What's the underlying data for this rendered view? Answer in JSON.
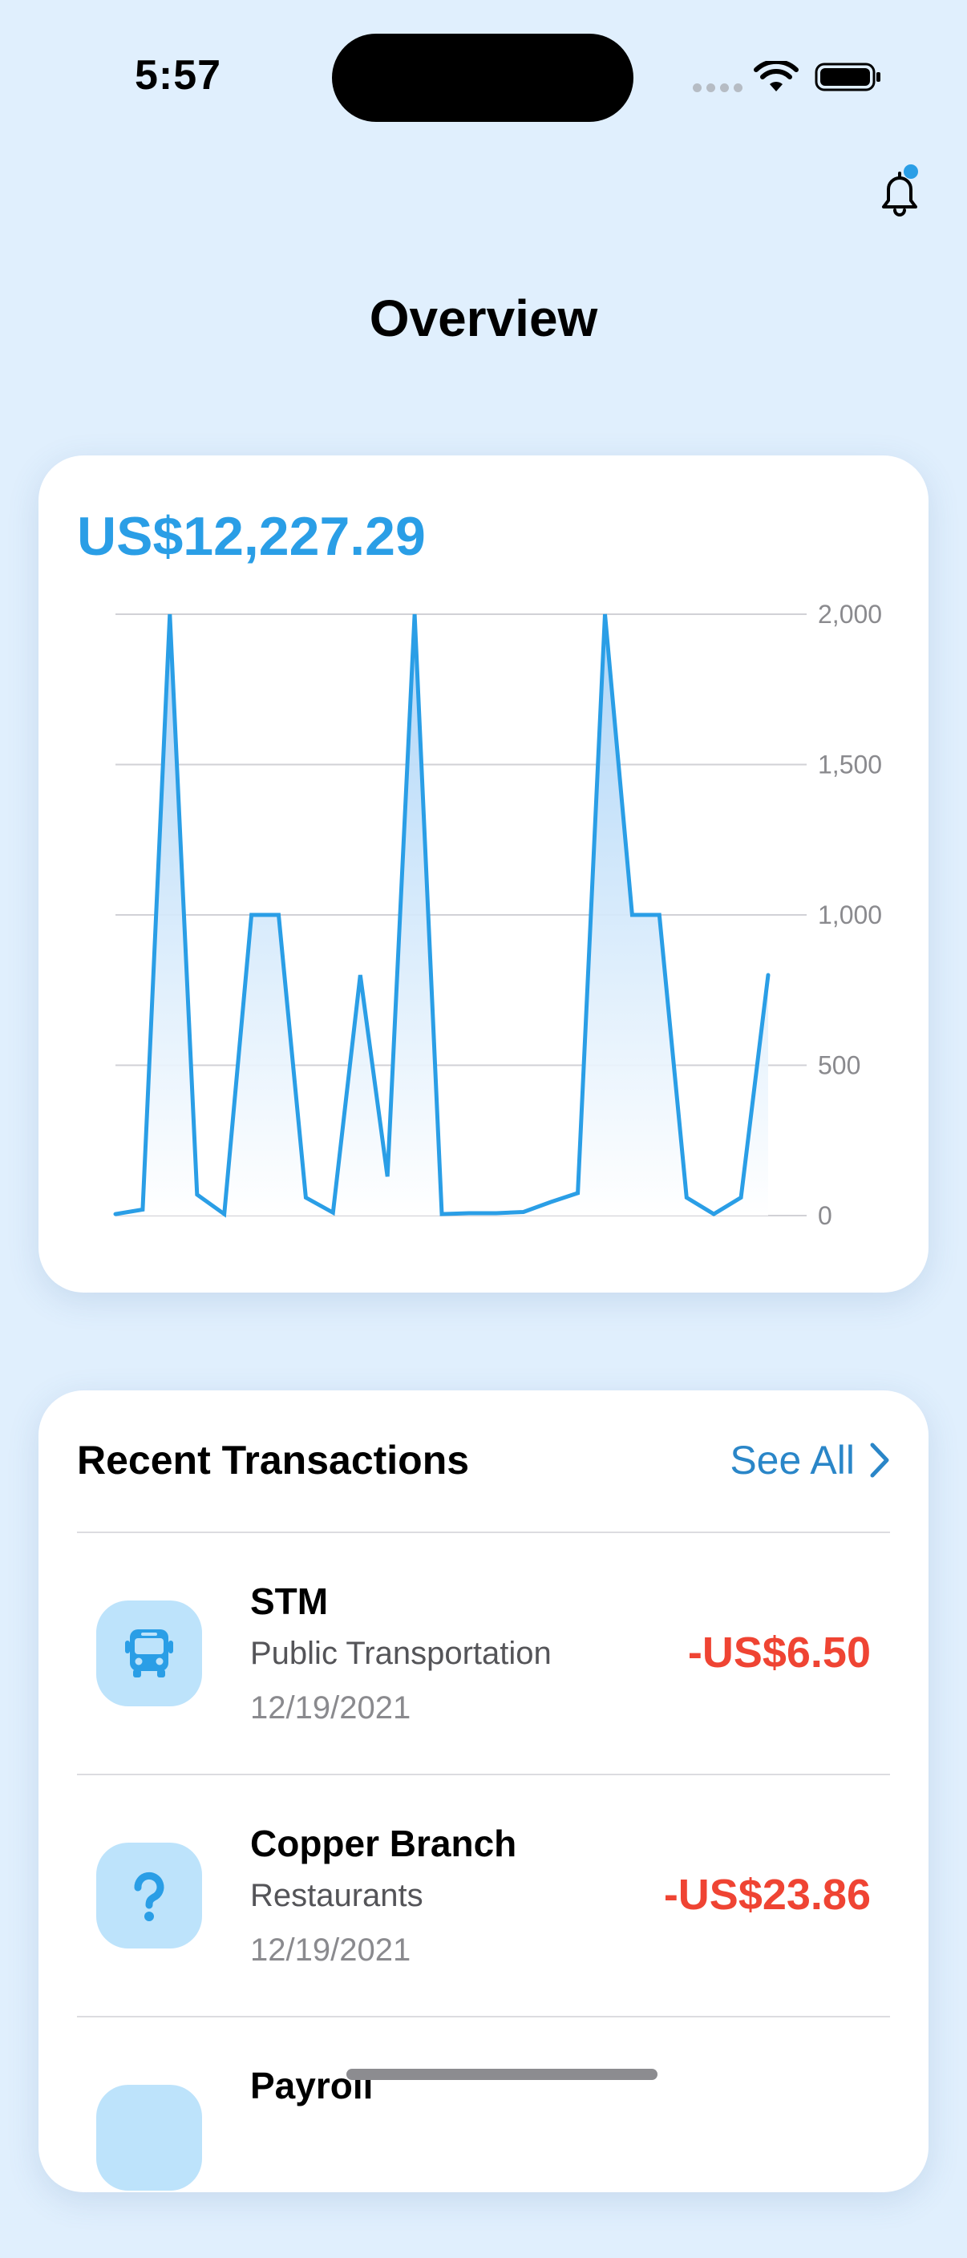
{
  "status_bar": {
    "time": "5:57",
    "icons": [
      "cellular-signal-icon",
      "wifi-icon",
      "battery-icon"
    ]
  },
  "header": {
    "notification_icon": "bell-icon",
    "notification_badge_color": "#2a9ee6",
    "title": "Overview"
  },
  "balance_card": {
    "balance": "US$12,227.29",
    "accent_color": "#2a9ee6"
  },
  "chart_data": {
    "type": "area",
    "title": "",
    "xlabel": "",
    "ylabel": "",
    "ylim": [
      0,
      2000
    ],
    "yticks": [
      "2,000",
      "1,500",
      "1,000",
      "500",
      "0"
    ],
    "ytick_values": [
      2000,
      1500,
      1000,
      500,
      0
    ],
    "y_axis_position": "right",
    "grid": true,
    "series": [
      {
        "values": [
          5,
          20,
          2000,
          70,
          5,
          1000,
          1000,
          60,
          10,
          800,
          130,
          2000,
          5,
          8,
          8,
          12,
          45,
          75,
          2000,
          1000,
          1000,
          60,
          5,
          60,
          800
        ]
      }
    ],
    "line_color": "#2a9ee6"
  },
  "transactions": {
    "title": "Recent Transactions",
    "see_all_label": "See All",
    "items": [
      {
        "name": "STM",
        "category": "Public Transportation",
        "date": "12/19/2021",
        "amount": "-US$6.50",
        "icon": "bus-icon"
      },
      {
        "name": "Copper Branch",
        "category": "Restaurants",
        "date": "12/19/2021",
        "amount": "-US$23.86",
        "icon": "question-mark-icon"
      },
      {
        "name": "Payroll",
        "icon": "transaction-icon"
      }
    ]
  }
}
